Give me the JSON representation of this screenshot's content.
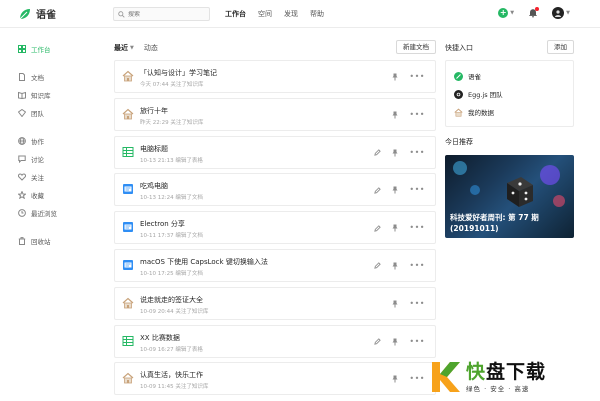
{
  "header": {
    "app_name": "语雀",
    "search_placeholder": "搜索",
    "nav": [
      "工作台",
      "空间",
      "发现",
      "帮助"
    ],
    "active_nav": "工作台",
    "brand_color": "#25b864"
  },
  "sidebar": {
    "items": [
      {
        "label": "工作台",
        "icon": "workbench-icon",
        "active": true
      },
      {
        "label": "文档",
        "icon": "document-icon"
      },
      {
        "label": "知识库",
        "icon": "book-icon"
      },
      {
        "label": "团队",
        "icon": "team-icon"
      },
      {
        "label": "协作",
        "icon": "globe-icon"
      },
      {
        "label": "讨论",
        "icon": "chat-icon"
      },
      {
        "label": "关注",
        "icon": "heart-icon"
      },
      {
        "label": "收藏",
        "icon": "star-icon"
      },
      {
        "label": "最近浏览",
        "icon": "clock-icon"
      },
      {
        "label": "回收站",
        "icon": "trash-icon"
      }
    ]
  },
  "main": {
    "tab_recent": "最近",
    "tab_activity": "动态",
    "new_doc_label": "新建文档",
    "docs": [
      {
        "title": "「认知与设计」学习笔记",
        "meta": "今天 07:44 关注了知识库",
        "icon": "house-icon",
        "edit": false
      },
      {
        "title": "旅行十年",
        "meta": "昨天 22:29 关注了知识库",
        "icon": "house-icon",
        "edit": false
      },
      {
        "title": "电脑标题",
        "meta": "10-13 21:13 编辑了表格",
        "icon": "sheet-icon",
        "edit": true
      },
      {
        "title": "吃鸡电脑",
        "meta": "10-13 12:24 编辑了文档",
        "icon": "doc-icon",
        "edit": true
      },
      {
        "title": "Electron 分享",
        "meta": "10-11 17:37 编辑了文档",
        "icon": "doc-icon",
        "edit": true
      },
      {
        "title": "macOS 下使用 CapsLock 键切换输入法",
        "meta": "10-10 17:25 编辑了文档",
        "icon": "doc-icon",
        "edit": true
      },
      {
        "title": "说走就走的签证大全",
        "meta": "10-09 20:44 关注了知识库",
        "icon": "house-icon",
        "edit": false
      },
      {
        "title": "XX 比赛数据",
        "meta": "10-09 16:27 编辑了表格",
        "icon": "sheet-icon",
        "edit": true
      },
      {
        "title": "认真生活，快乐工作",
        "meta": "10-09 11:45 关注了知识库",
        "icon": "house-icon",
        "edit": false
      }
    ]
  },
  "right": {
    "quick_title": "快捷入口",
    "add_label": "添加",
    "quick_items": [
      {
        "label": "语雀",
        "icon": "yuque-icon"
      },
      {
        "label": "Egg.js 团队",
        "icon": "egg-icon"
      },
      {
        "label": "我的数据",
        "icon": "house-icon"
      }
    ],
    "today_title": "今日推荐",
    "rec_line1": "科技爱好者周刊: 第 77 期",
    "rec_line2": "(20191011)"
  },
  "watermark": {
    "big_1": "快",
    "big_2": "盘下载",
    "small": "绿色 · 安全 · 高速"
  }
}
